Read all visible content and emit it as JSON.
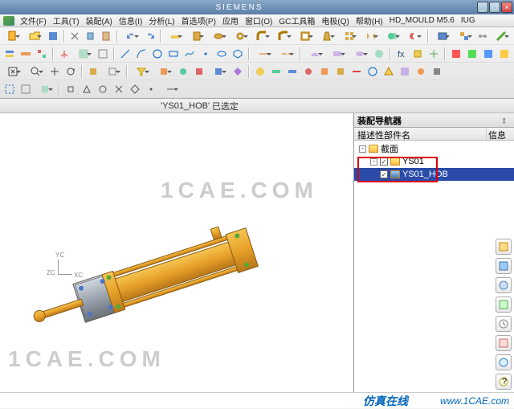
{
  "title_brand": "SIEMENS",
  "menus": [
    "文件(F)",
    "工具(T)",
    "装配(A)",
    "信息(I)",
    "分析(L)",
    "首选项(P)",
    "应用",
    "窗口(O)",
    "GC工具箱",
    "电极(Q)",
    "帮助(H)",
    "HD_MOULD M5.6",
    "IUG"
  ],
  "status_file": "'YS01_HOB'",
  "status_state": "已选定",
  "nav": {
    "title": "装配导航器",
    "col1": "描述性部件名",
    "col2": "信息",
    "items": [
      {
        "label": "截面",
        "level": 0,
        "sel": false,
        "check": false,
        "exp": "-"
      },
      {
        "label": "YS01",
        "level": 1,
        "sel": false,
        "check": true,
        "exp": "-"
      },
      {
        "label": "YS01_HOB",
        "level": 2,
        "sel": true,
        "check": true,
        "exp": ""
      }
    ]
  },
  "axis": {
    "x": "XC",
    "y": "YC",
    "z": "ZC"
  },
  "watermark": "1CAE.COM",
  "bottom_cn": "仿真在线",
  "bottom_url": "www.1CAE.com"
}
